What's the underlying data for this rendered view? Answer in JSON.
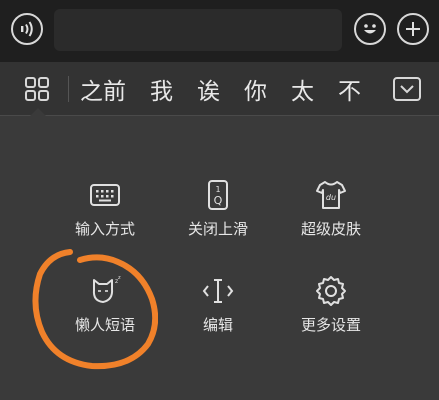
{
  "topbar": {
    "voice_icon": "voice-icon",
    "emoji_icon": "emoji-icon",
    "plus_icon": "plus-icon",
    "input_value": ""
  },
  "candidates": {
    "items": [
      "之前",
      "我",
      "诶",
      "你",
      "太",
      "不"
    ],
    "grid_icon": "grid-menu-icon",
    "collapse_icon": "keyboard-collapse-icon"
  },
  "tools": [
    {
      "label": "输入方式",
      "icon": "keyboard-icon"
    },
    {
      "label": "关闭上滑",
      "icon": "swipe-up-icon"
    },
    {
      "label": "超级皮肤",
      "icon": "skin-shirt-icon"
    },
    {
      "label": "懒人短语",
      "icon": "lazy-cat-icon"
    },
    {
      "label": "编辑",
      "icon": "cursor-edit-icon"
    },
    {
      "label": "更多设置",
      "icon": "gear-icon"
    }
  ],
  "colors": {
    "topbar_bg": "#1f1f1f",
    "panel_bg": "#3a3a3a",
    "highlight_circle": "#f0812a"
  }
}
